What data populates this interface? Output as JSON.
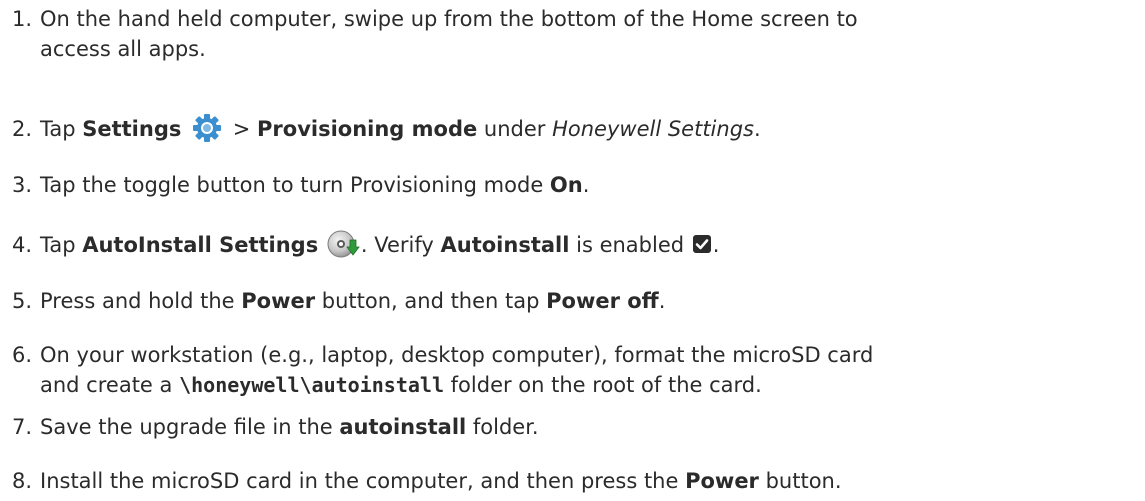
{
  "steps": [
    {
      "number": "1.",
      "line1": "On the hand held computer, swipe up from the bottom of the Home screen to",
      "line2": "access all apps."
    },
    {
      "number": "2.",
      "t1": "Tap ",
      "b1": "Settings",
      "t2": " > ",
      "b2": "Provisioning mode",
      "t3": " under ",
      "i1": "Honeywell Settings",
      "t4": ".",
      "icon": "gear-icon"
    },
    {
      "number": "3.",
      "t1": "Tap the toggle button to turn Provisioning mode ",
      "b1": "On",
      "t2": "."
    },
    {
      "number": "4.",
      "t1": "Tap ",
      "b1": "AutoInstall Settings",
      "t2": ". Verify ",
      "b2": "Autoinstall",
      "t3": " is enabled ",
      "t4": ".",
      "icon1": "autoinstall-disc-icon",
      "icon2": "checked-checkbox-icon"
    },
    {
      "number": "5.",
      "t1": "Press and hold the ",
      "b1": "Power",
      "t2": " button, and then tap ",
      "b2": "Power off",
      "t3": "."
    },
    {
      "number": "6.",
      "line1": "On your workstation (e.g., laptop, desktop computer), format the microSD card",
      "t1": "and create a ",
      "code": "\\honeywell\\autoinstall",
      "t2": " folder on the root of the card."
    },
    {
      "number": "7.",
      "t1": "Save the upgrade file in the ",
      "b1": "autoinstall",
      "t2": " folder."
    },
    {
      "number": "8.",
      "t1": "Install the microSD card in the computer, and then press the ",
      "b1": "Power",
      "t2": " button."
    }
  ],
  "colors": {
    "text": "#2b2b2b",
    "gear": "#3b8fcf",
    "arrow": "#2e9a3a"
  }
}
